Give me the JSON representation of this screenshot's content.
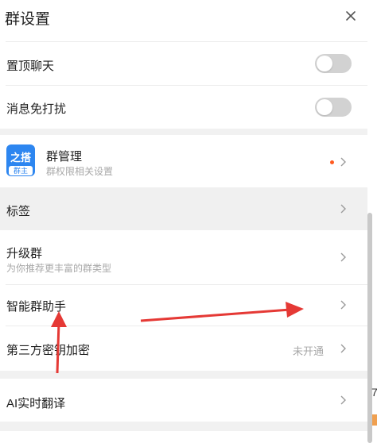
{
  "header": {
    "title": "群设置"
  },
  "settings": {
    "pin_chat": {
      "label": "置顶聊天",
      "enabled": false
    },
    "mute": {
      "label": "消息免打扰",
      "enabled": false
    }
  },
  "group_admin": {
    "avatar_top": "之搭",
    "avatar_badge": "群主",
    "title": "群管理",
    "subtitle": "群权限相关设置"
  },
  "rows": {
    "tags": {
      "label": "标签"
    },
    "upgrade": {
      "label": "升级群",
      "subtitle": "为你推荐更丰富的群类型"
    },
    "assistant": {
      "label": "智能群助手"
    },
    "encryption": {
      "label": "第三方密钥加密",
      "status": "未开通"
    },
    "translate": {
      "label": "AI实时翻译"
    }
  },
  "edge": {
    "text": "7"
  },
  "colors": {
    "accent_blue": "#2d86f0",
    "notice_dot": "#ff5a1f",
    "annotation_arrow": "#e53935",
    "hover_row": "#f0f0f0",
    "section_gap": "#f1f1f1"
  }
}
